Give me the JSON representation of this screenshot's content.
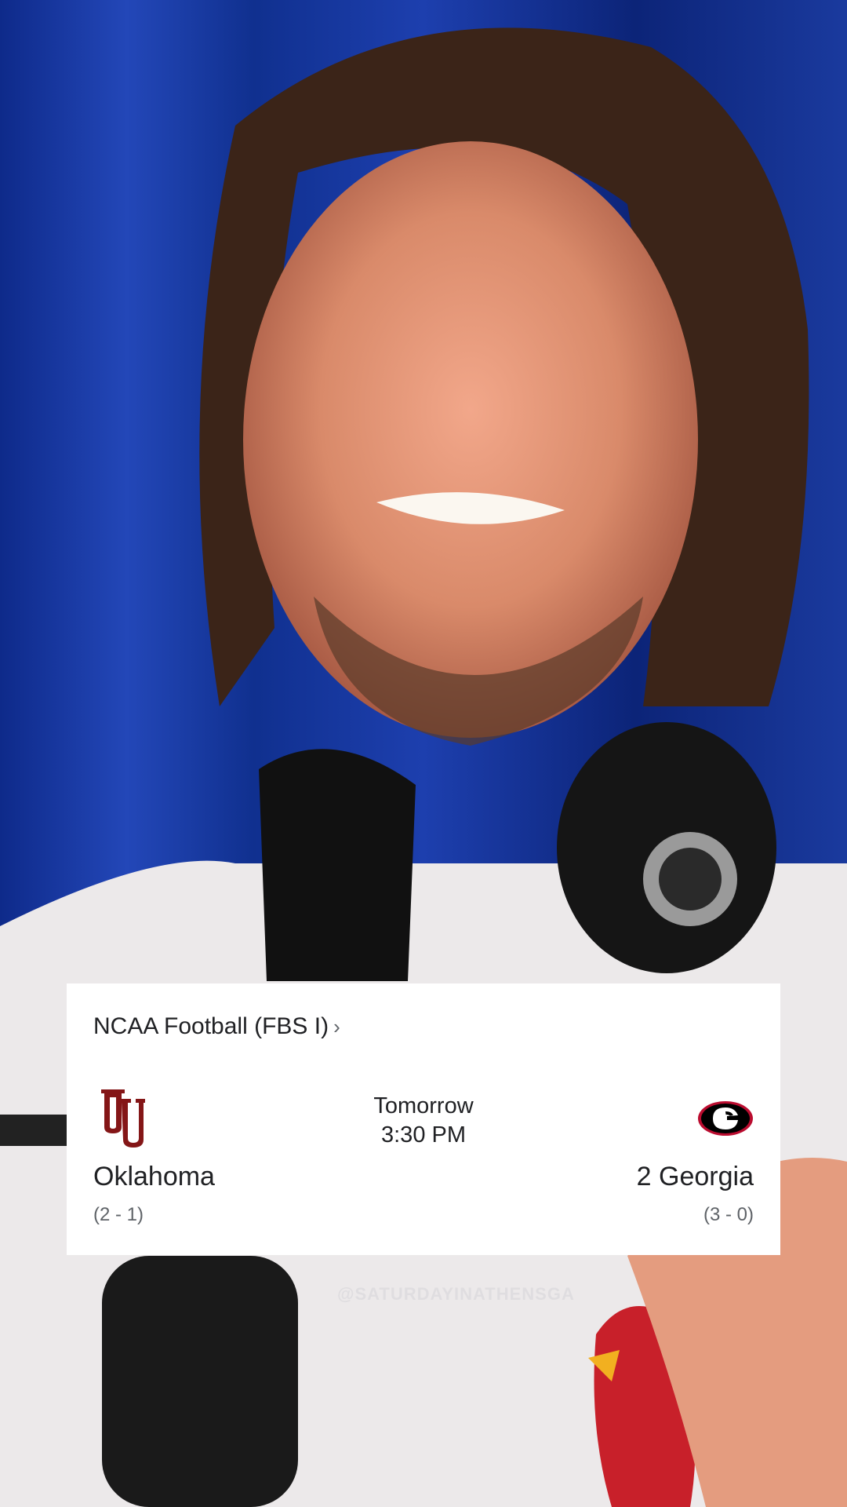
{
  "scorecard": {
    "league": "NCAA Football (FBS I)",
    "league_chevron": "›",
    "day": "Tomorrow",
    "time": "3:30 PM",
    "home_team": {
      "name": "Oklahoma",
      "record": "(2 - 1)",
      "logo": "oklahoma-ou-logo",
      "color": "#841617"
    },
    "away_team": {
      "name": "2 Georgia",
      "record": "(3 - 0)",
      "logo": "georgia-g-logo",
      "color": "#ba0c2f"
    }
  },
  "watermark": "@SATURDAYINATHENSGA",
  "colors": {
    "background_curtain": "#1a3a9e",
    "card": "#ffffff",
    "text": "#202124",
    "subtext": "#5f6368"
  }
}
